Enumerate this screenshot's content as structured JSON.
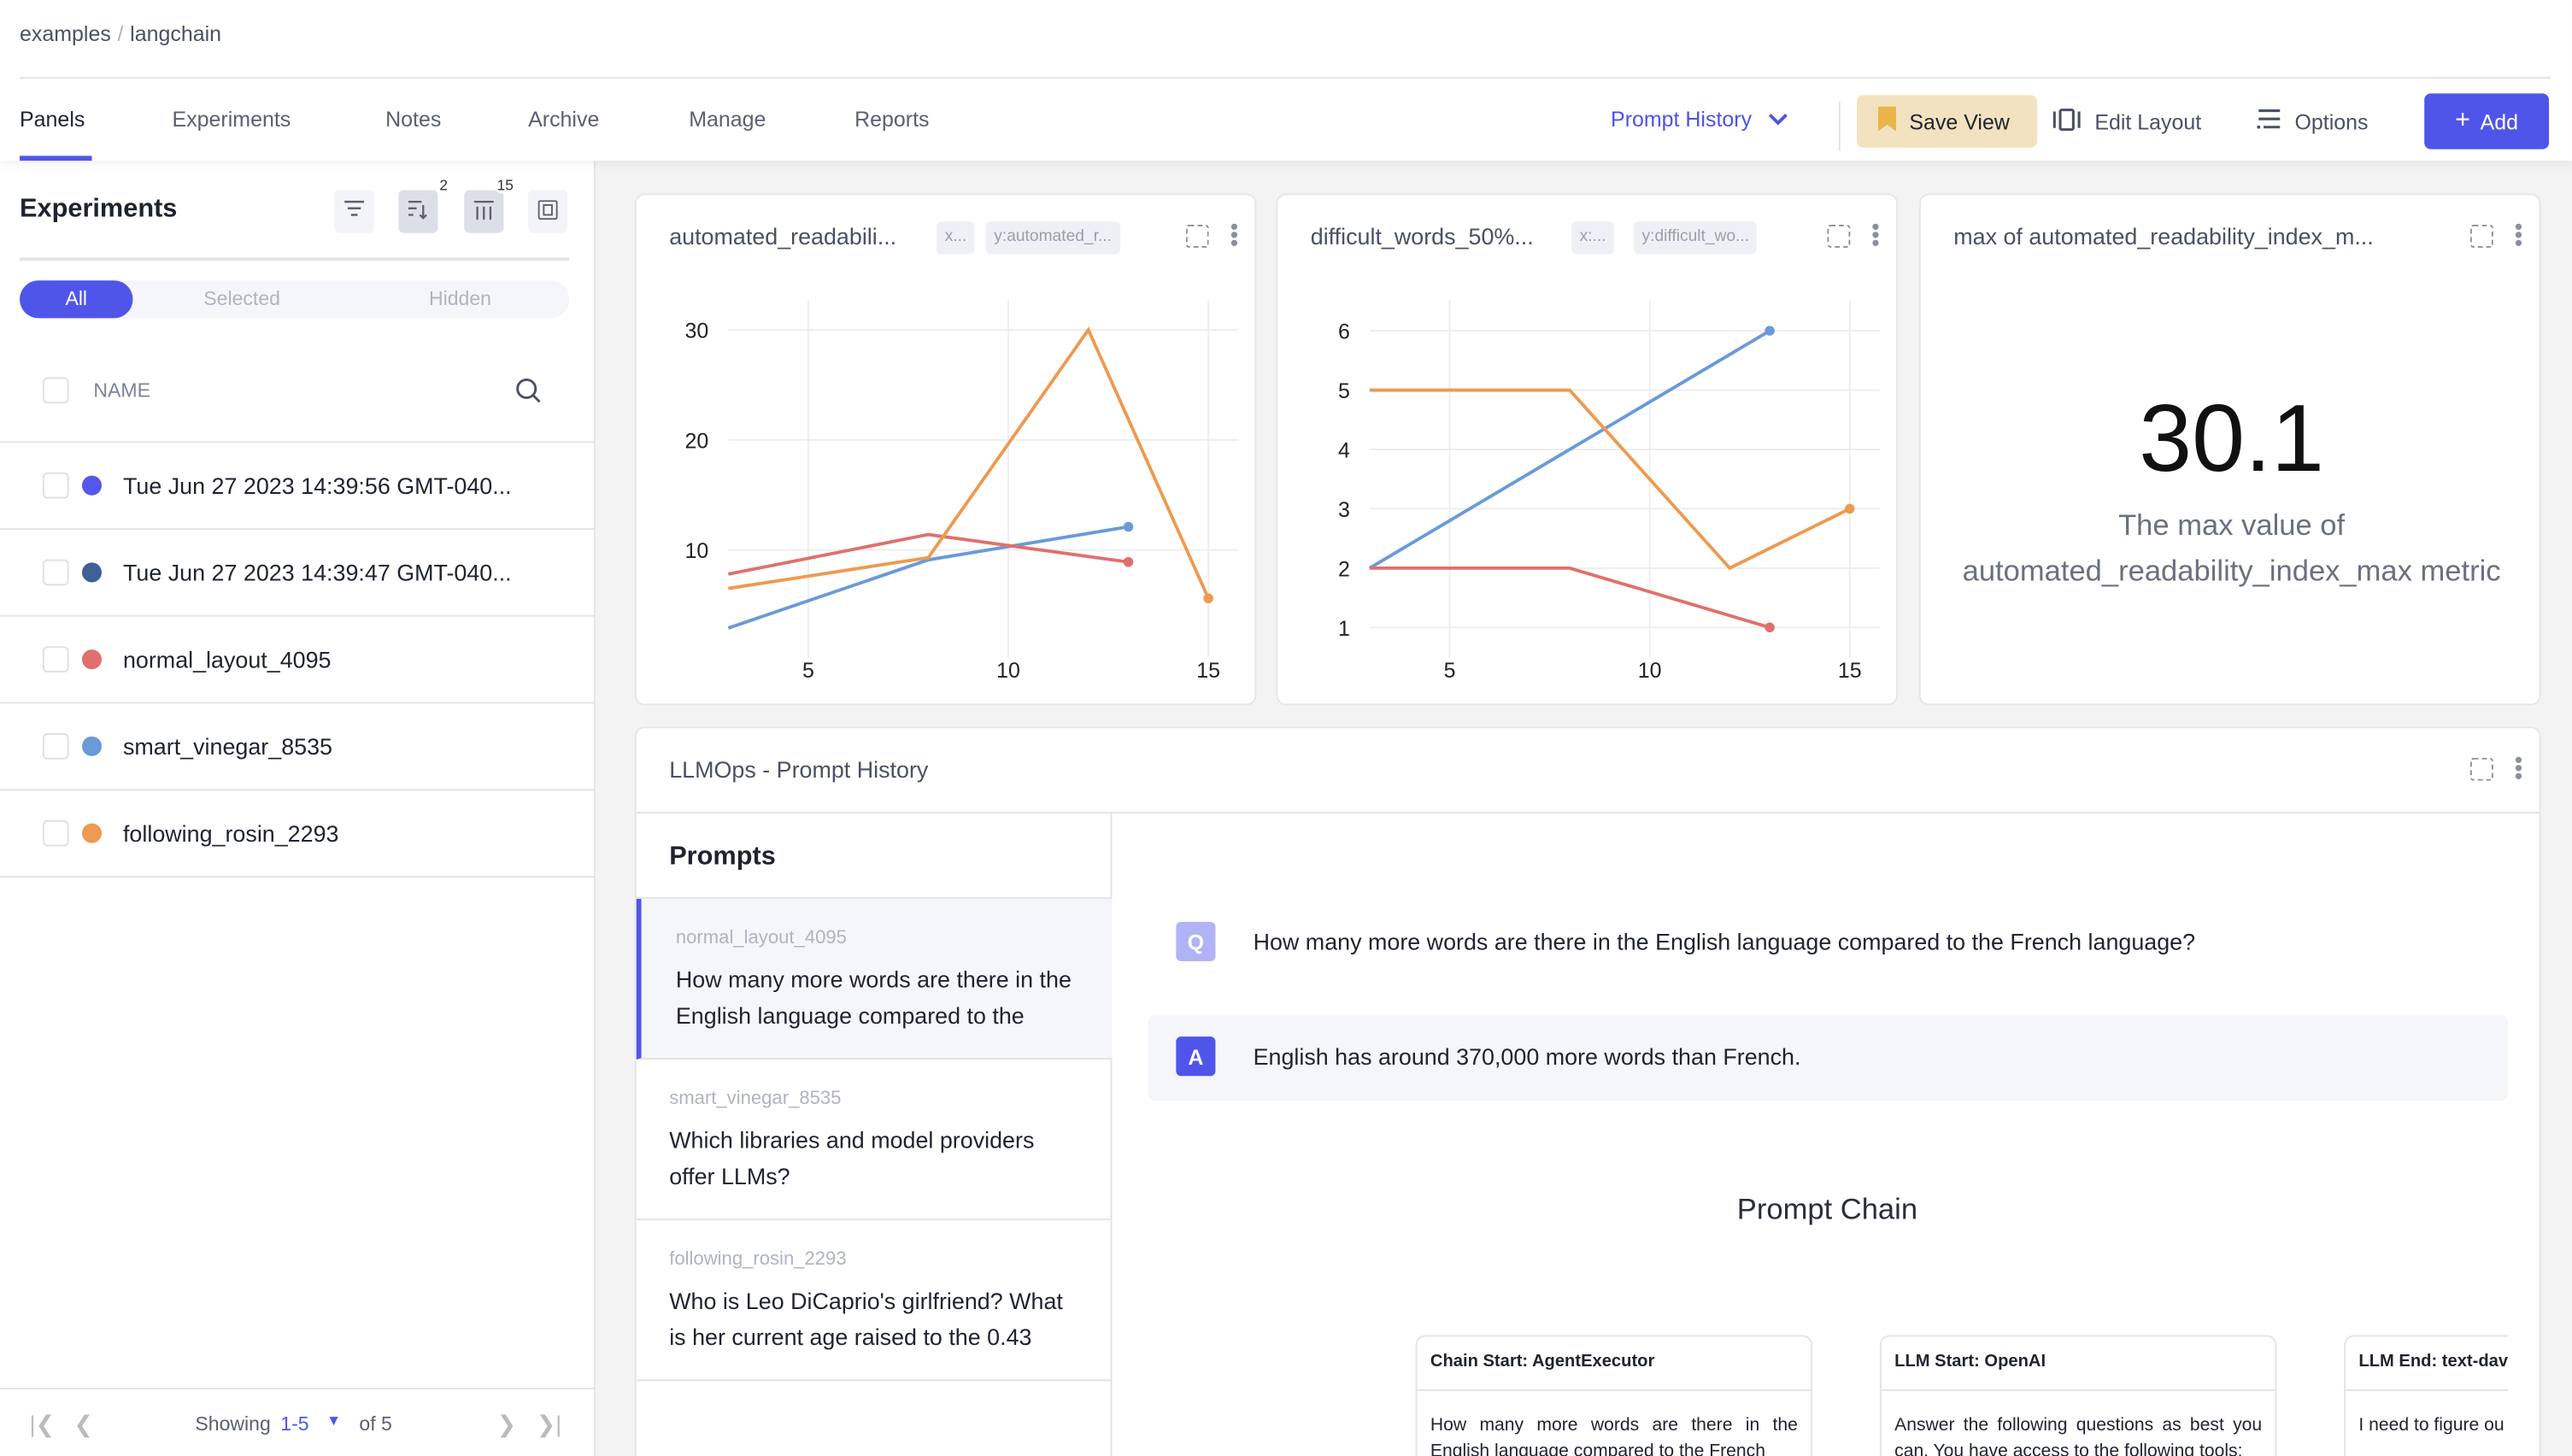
{
  "breadcrumb": {
    "parent": "examples",
    "separator": "/",
    "current": "langchain"
  },
  "tabs": [
    {
      "label": "Panels",
      "active": true
    },
    {
      "label": "Experiments"
    },
    {
      "label": "Notes"
    },
    {
      "label": "Archive"
    },
    {
      "label": "Manage"
    },
    {
      "label": "Reports"
    }
  ],
  "toolbar": {
    "view_select": "Prompt History",
    "save_view": "Save View",
    "edit_layout": "Edit Layout",
    "options": "Options",
    "add": "Add"
  },
  "colors": {
    "accent": "#5055ea",
    "save_bg": "#f2e2bf"
  },
  "sidebar": {
    "title": "Experiments",
    "icon_badges": {
      "sort": "2",
      "columns": "15"
    },
    "filters": [
      "All",
      "Selected",
      "Hidden"
    ],
    "active_filter": "All",
    "column_header": "NAME",
    "experiments": [
      {
        "name": "Tue Jun 27 2023 14:39:56 GMT-040...",
        "color": "#5558ea"
      },
      {
        "name": "Tue Jun 27 2023 14:39:47 GMT-040...",
        "color": "#3e6196"
      },
      {
        "name": "normal_layout_4095",
        "color": "#e0706d"
      },
      {
        "name": "smart_vinegar_8535",
        "color": "#6a9ad8"
      },
      {
        "name": "following_rosin_2293",
        "color": "#ee9a50"
      }
    ],
    "pagination": {
      "prefix": "Showing",
      "range": "1-5",
      "suffix": "of 5"
    }
  },
  "panels": [
    {
      "title": "automated_readabili...",
      "x_chip": "x...",
      "y_chip": "y:automated_r..."
    },
    {
      "title": "difficult_words_50%...",
      "x_chip": "x:...",
      "y_chip": "y:difficult_wo..."
    },
    {
      "title": "max of automated_readability_index_m...",
      "value": "30.1",
      "desc1": "The max value of",
      "desc2": "automated_readability_index_max metric"
    }
  ],
  "chart_data": [
    {
      "type": "line",
      "xticks": [
        5,
        10,
        15
      ],
      "yticks": [
        10,
        20,
        30
      ],
      "xlim": [
        3,
        15.75
      ],
      "ylim": [
        0.8,
        31.8
      ],
      "grid": true,
      "series": [
        {
          "color": "#6a9ad8",
          "x": [
            3,
            8,
            13
          ],
          "y": [
            2.9,
            9.1,
            12.1
          ]
        },
        {
          "color": "#e0706d",
          "x": [
            3,
            8,
            13
          ],
          "y": [
            7.8,
            11.4,
            8.9
          ]
        },
        {
          "color": "#ee9a50",
          "x": [
            3,
            8,
            12,
            15
          ],
          "y": [
            6.5,
            9.3,
            30,
            5.6
          ]
        }
      ]
    },
    {
      "type": "line",
      "xticks": [
        5,
        10,
        15
      ],
      "yticks": [
        1,
        2,
        3,
        4,
        5,
        6
      ],
      "xlim": [
        3,
        15.75
      ],
      "ylim": [
        0.6,
        6.35
      ],
      "grid": true,
      "series": [
        {
          "color": "#6a9ad8",
          "x": [
            3,
            13
          ],
          "y": [
            2,
            6
          ]
        },
        {
          "color": "#e0706d",
          "x": [
            3,
            8,
            13
          ],
          "y": [
            2,
            2,
            1
          ]
        },
        {
          "color": "#ee9a50",
          "x": [
            3,
            8,
            12,
            15
          ],
          "y": [
            5,
            5,
            2,
            3
          ]
        }
      ]
    }
  ],
  "prompt_history": {
    "title": "LLMOps - Prompt History",
    "prompts_header": "Prompts",
    "prompts": [
      {
        "experiment": "normal_layout_4095",
        "text": "How many more words are there in the English language compared to the",
        "selected": true
      },
      {
        "experiment": "smart_vinegar_8535",
        "text": "Which libraries and model providers offer LLMs?"
      },
      {
        "experiment": "following_rosin_2293",
        "text": "Who is Leo DiCaprio's girlfriend? What is her current age raised to the 0.43"
      }
    ],
    "question_label": "Q",
    "question": "How many more words are there in the English language compared to the French language?",
    "answer_label": "A",
    "answer": "English has around 370,000 more words than French.",
    "chain_title": "Prompt Chain",
    "chain": [
      {
        "title": "Chain Start: AgentExecutor",
        "body": "How many more words are there in the English language compared to the French"
      },
      {
        "title": "LLM Start: OpenAI",
        "body": "Answer the following questions as best you can. You have access to the following tools:"
      },
      {
        "title": "LLM End: text-dav",
        "body": "I need to figure ou the English langua"
      }
    ]
  }
}
